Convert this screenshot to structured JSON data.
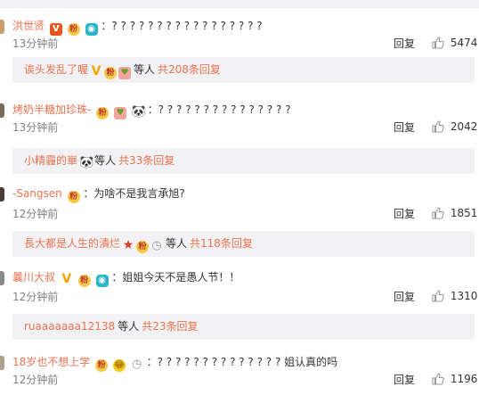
{
  "comments": [
    {
      "username": "洪世贤",
      "text": "：? ? ? ? ? ? ? ? ? ? ? ? ? ? ? ? ?",
      "time": "13分钟前",
      "reply_label": "回复",
      "likes": "5474",
      "avatar_color": "#c8a070",
      "sub": {
        "username": "诶头发乱了喔",
        "etc": "等人",
        "total": "共208条回复"
      }
    },
    {
      "username": "烤奶半糖加珍珠-",
      "text": "：? ? ? ? ? ? ? ? ? ? ? ? ? ? ?",
      "time": "13分钟前",
      "reply_label": "回复",
      "likes": "2042",
      "avatar_color": "#7a6a58",
      "sub": {
        "username": "小精霾的崋",
        "etc": "等人",
        "total": "共33条回复"
      }
    },
    {
      "username": "-Sangsen",
      "text": "：为啥不是我言承旭?",
      "time": "12分钟前",
      "reply_label": "回复",
      "likes": "1851",
      "avatar_color": "#4a3c3a",
      "sub": {
        "username": "長大都是人生的潰烂",
        "etc": "等人",
        "total": "共118条回复"
      }
    },
    {
      "username": "曩川大叔",
      "text": "：姐姐今天不是愚人节！！",
      "time": "12分钟前",
      "reply_label": "回复",
      "likes": "1310",
      "avatar_color": "#8a8a8a",
      "sub": {
        "username": "ruaaaaaaa12138",
        "etc": "等人",
        "total": "共23条回复"
      }
    },
    {
      "username": "18岁也不想上学",
      "text": "：? ? ? ? ? ? ? ? ? ? ? ? ? ? 姐认真的吗",
      "time": "12分钟前",
      "reply_label": "回复",
      "likes": "1196",
      "avatar_color": "#b0a090"
    }
  ],
  "icons": {
    "v_red": "V",
    "v_gold": "V",
    "fan": "粉",
    "camera": "◉",
    "gift": "♥",
    "panda": "🐼",
    "star": "★",
    "clock": "◷",
    "laugh": "😂"
  },
  "colors": {
    "username": "#eb7350",
    "subbox_bg": "#f2f2f5",
    "muted": "#808080"
  }
}
